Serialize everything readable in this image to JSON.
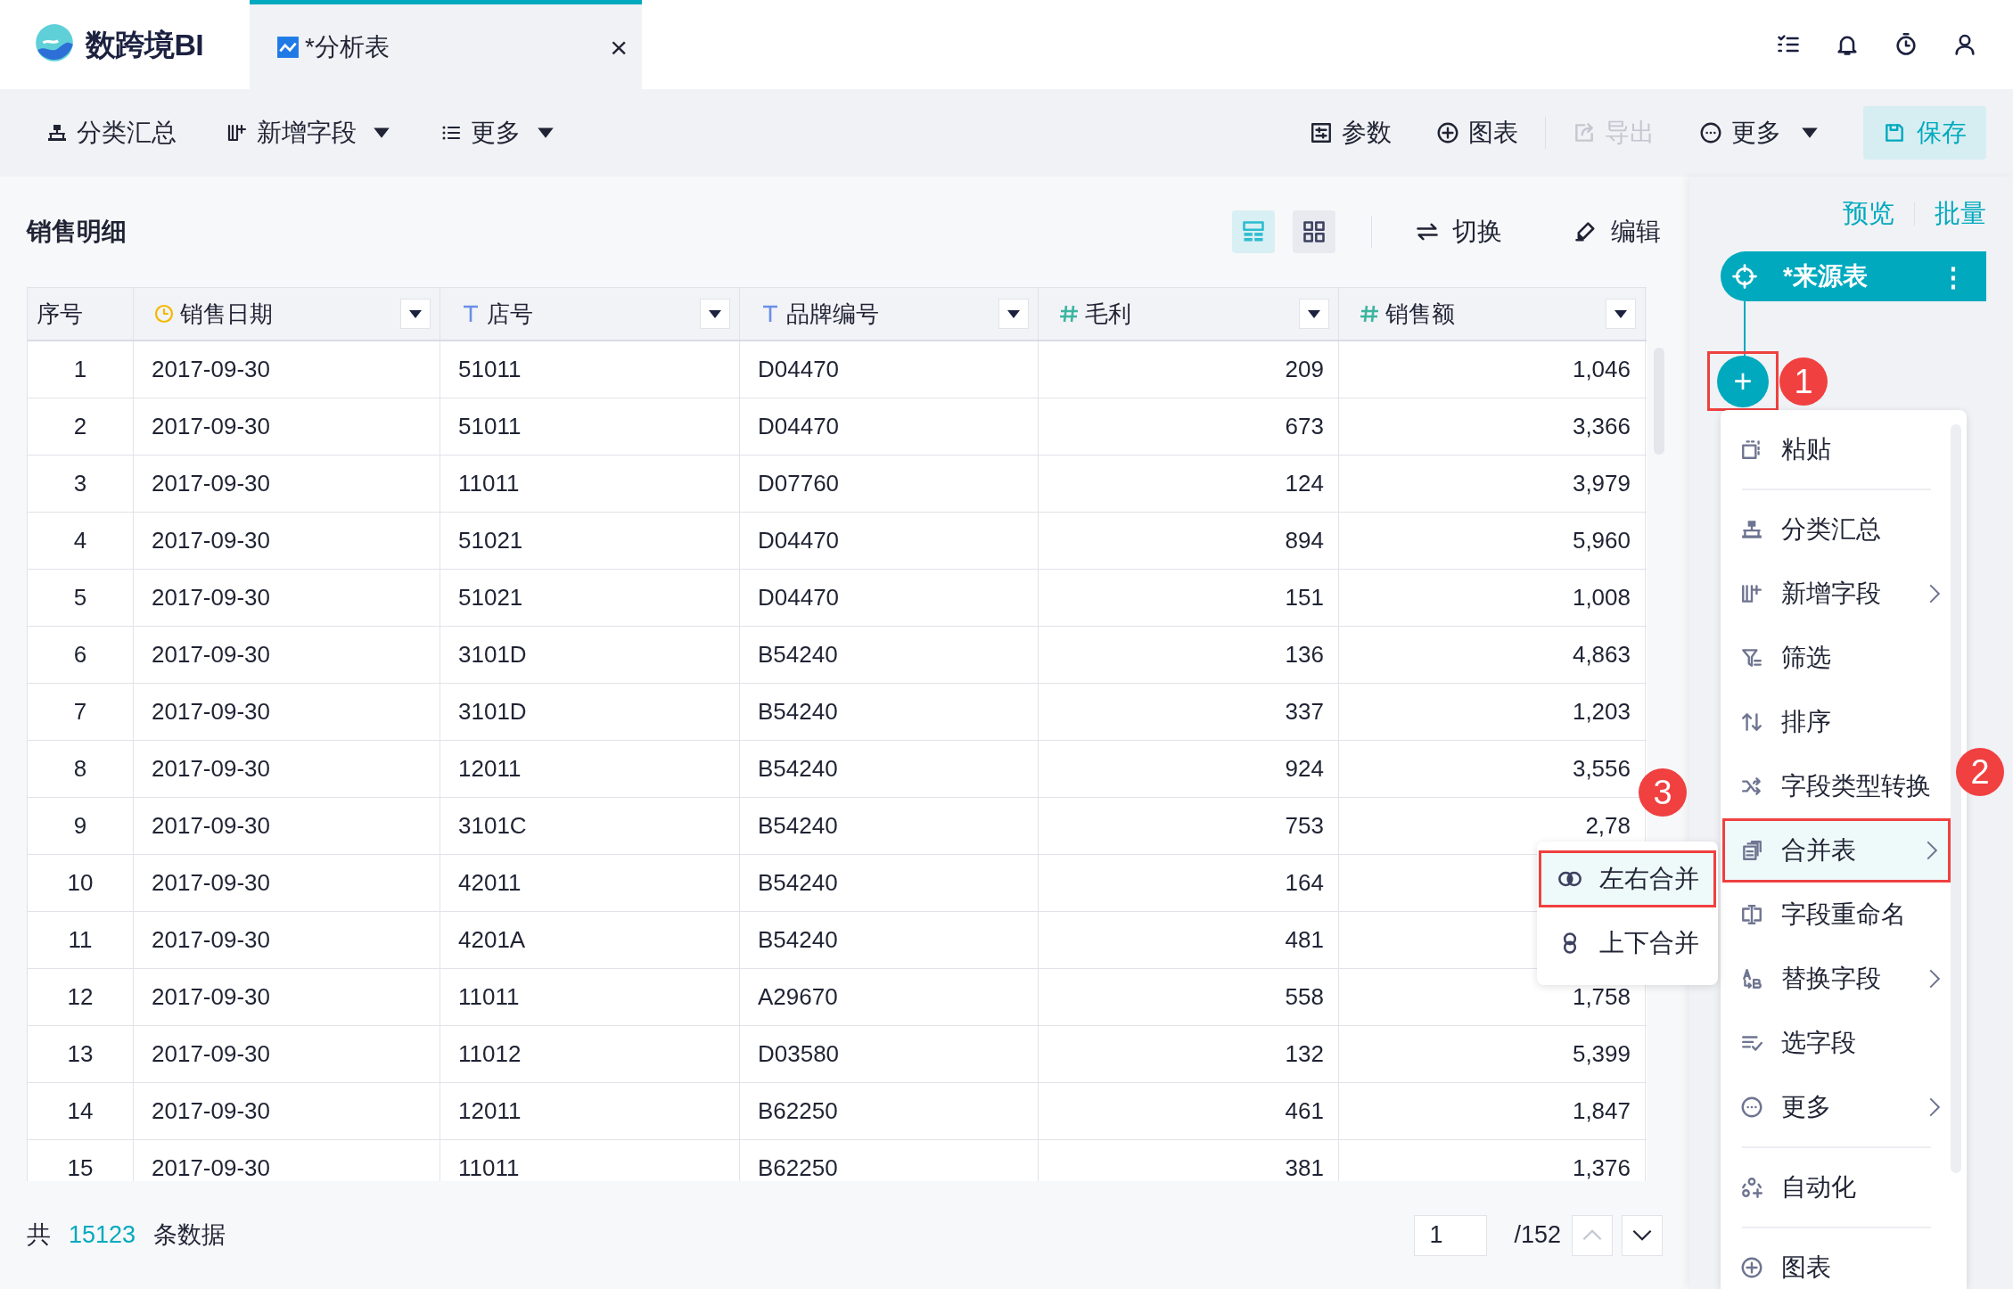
{
  "app": {
    "logo_text": "数跨境BI"
  },
  "tabs": [
    {
      "label": "*分析表",
      "selected": true,
      "close": "×"
    }
  ],
  "toolbar_left": [
    {
      "label": "分类汇总",
      "kind": "hierarchy",
      "dropdown": false
    },
    {
      "label": "新增字段",
      "kind": "add-column",
      "dropdown": true
    },
    {
      "label": "更多",
      "kind": "list",
      "dropdown": true
    }
  ],
  "toolbar_right": [
    {
      "label": "参数",
      "kind": "sliders",
      "dropdown": false,
      "disabled": false,
      "primary": false
    },
    {
      "label": "图表",
      "kind": "plus-circle",
      "dropdown": false,
      "disabled": false,
      "primary": false
    },
    {
      "label": "导出",
      "kind": "export",
      "dropdown": false,
      "disabled": true,
      "primary": false
    },
    {
      "label": "更多",
      "kind": "more",
      "dropdown": true,
      "disabled": false,
      "primary": false
    },
    {
      "label": "保存",
      "kind": "save",
      "dropdown": false,
      "disabled": false,
      "primary": true
    }
  ],
  "panel": {
    "title": "销售明细",
    "view_modes": [
      {
        "kind": "table",
        "selected": true
      },
      {
        "kind": "grid",
        "selected": false
      }
    ],
    "actions": [
      {
        "label": "切换",
        "kind": "swap"
      },
      {
        "label": "编辑",
        "kind": "edit"
      }
    ]
  },
  "table": {
    "columns": [
      {
        "label": "序号",
        "kind": "index"
      },
      {
        "label": "销售日期",
        "kind": "date"
      },
      {
        "label": "店号",
        "kind": "text"
      },
      {
        "label": "品牌编号",
        "kind": "text"
      },
      {
        "label": "毛利",
        "kind": "number"
      },
      {
        "label": "销售额",
        "kind": "number"
      }
    ],
    "rows": [
      [
        "1",
        "2017-09-30",
        "51011",
        "D04470",
        "209",
        "1,046"
      ],
      [
        "2",
        "2017-09-30",
        "51011",
        "D04470",
        "673",
        "3,366"
      ],
      [
        "3",
        "2017-09-30",
        "11011",
        "D07760",
        "124",
        "3,979"
      ],
      [
        "4",
        "2017-09-30",
        "51021",
        "D04470",
        "894",
        "5,960"
      ],
      [
        "5",
        "2017-09-30",
        "51021",
        "D04470",
        "151",
        "1,008"
      ],
      [
        "6",
        "2017-09-30",
        "3101D",
        "B54240",
        "136",
        "4,863"
      ],
      [
        "7",
        "2017-09-30",
        "3101D",
        "B54240",
        "337",
        "1,203"
      ],
      [
        "8",
        "2017-09-30",
        "12011",
        "B54240",
        "924",
        "3,556"
      ],
      [
        "9",
        "2017-09-30",
        "3101C",
        "B54240",
        "753",
        "2,78"
      ],
      [
        "10",
        "2017-09-30",
        "42011",
        "B54240",
        "164"
      ],
      [
        "11",
        "2017-09-30",
        "4201A",
        "B54240",
        "481"
      ],
      [
        "12",
        "2017-09-30",
        "11011",
        "A29670",
        "558",
        "1,758"
      ],
      [
        "13",
        "2017-09-30",
        "11012",
        "D03580",
        "132",
        "5,399"
      ],
      [
        "14",
        "2017-09-30",
        "12011",
        "B62250",
        "461",
        "1,847"
      ],
      [
        "15",
        "2017-09-30",
        "11011",
        "B62250",
        "381",
        "1,376"
      ]
    ]
  },
  "footer": {
    "prefix": "共",
    "count": "15123",
    "suffix": "条数据",
    "page": "1",
    "total_pages": "/152"
  },
  "flow": {
    "links": [
      {
        "label": "预览"
      },
      {
        "label": "批量"
      }
    ],
    "node": {
      "label": "*来源表",
      "menu": "⋮"
    },
    "add_button": {
      "label": "+"
    }
  },
  "context_menu": {
    "items": [
      {
        "label": "粘贴",
        "kind": "paste",
        "submenu": false,
        "selected": false,
        "divider_after": true
      },
      {
        "label": "分类汇总",
        "kind": "hierarchy",
        "submenu": false,
        "selected": false,
        "divider_after": false
      },
      {
        "label": "新增字段",
        "kind": "add-column",
        "submenu": true,
        "selected": false,
        "divider_after": false
      },
      {
        "label": "筛选",
        "kind": "filter",
        "submenu": false,
        "selected": false,
        "divider_after": false
      },
      {
        "label": "排序",
        "kind": "sort",
        "submenu": false,
        "selected": false,
        "divider_after": false
      },
      {
        "label": "字段类型转换",
        "kind": "shuffle",
        "submenu": false,
        "selected": false,
        "divider_after": false
      },
      {
        "label": "合并表",
        "kind": "merge",
        "submenu": true,
        "selected": true,
        "divider_after": false
      },
      {
        "label": "字段重命名",
        "kind": "rename",
        "submenu": false,
        "selected": false,
        "divider_after": false
      },
      {
        "label": "替换字段",
        "kind": "replace",
        "submenu": true,
        "selected": false,
        "divider_after": false
      },
      {
        "label": "选字段",
        "kind": "select-fields",
        "submenu": false,
        "selected": false,
        "divider_after": false
      },
      {
        "label": "更多",
        "kind": "more",
        "submenu": true,
        "selected": false,
        "divider_after": true
      },
      {
        "label": "自动化",
        "kind": "automation",
        "submenu": false,
        "selected": false,
        "divider_after": true
      },
      {
        "label": "图表",
        "kind": "plus-circle",
        "submenu": false,
        "selected": false,
        "divider_after": false
      }
    ]
  },
  "submenu": {
    "items": [
      {
        "label": "左右合并",
        "kind": "join-lr",
        "selected": true
      },
      {
        "label": "上下合并",
        "kind": "join-tb",
        "selected": false
      }
    ]
  },
  "annotations": [
    {
      "label": "1"
    },
    {
      "label": "2"
    },
    {
      "label": "3"
    }
  ]
}
